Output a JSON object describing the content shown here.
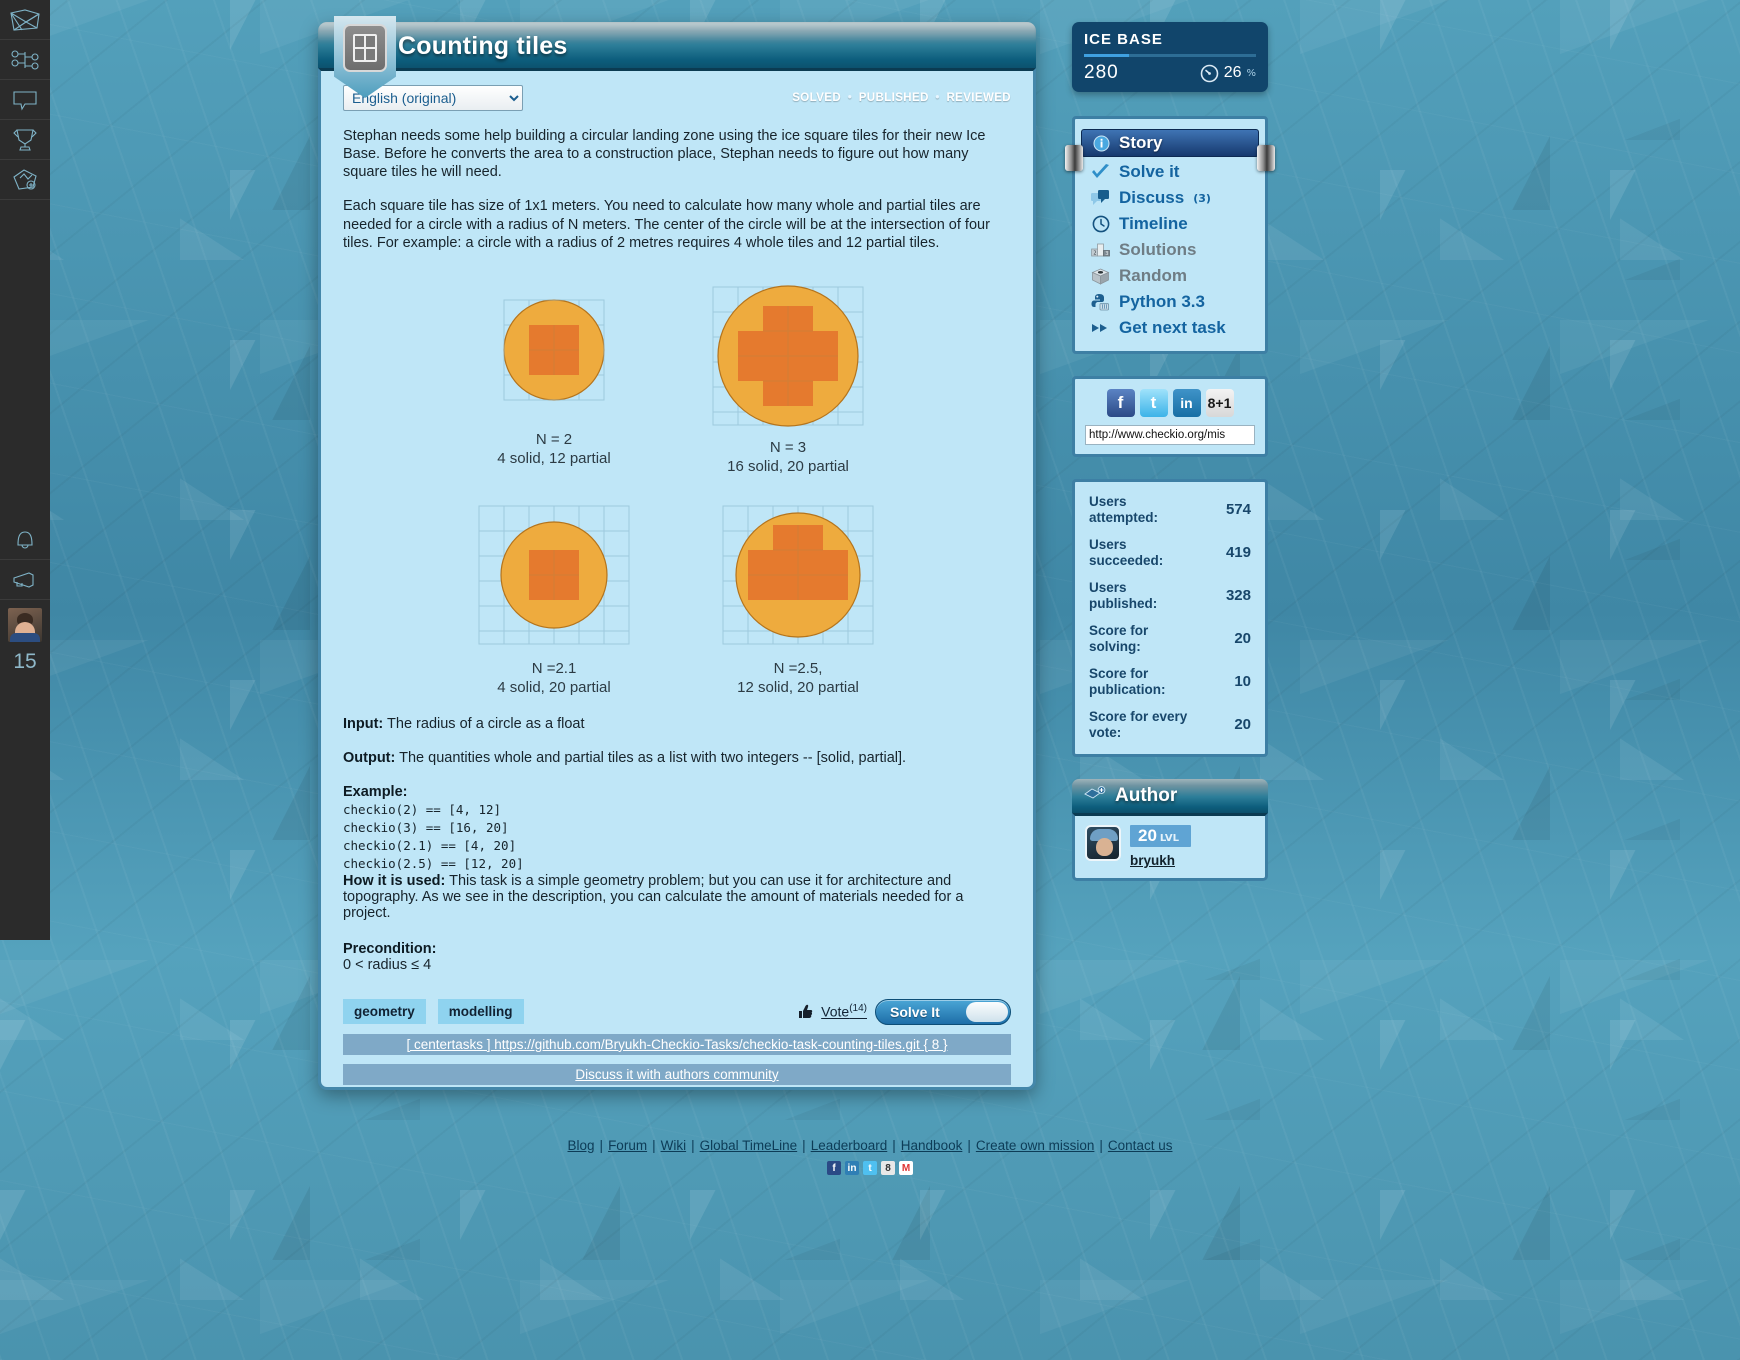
{
  "leftrail": {
    "items": [
      {
        "name": "mail-icon",
        "label": "Mail"
      },
      {
        "name": "network-icon",
        "label": "Map tree"
      },
      {
        "name": "speech-bubble-icon",
        "label": "Comments"
      },
      {
        "name": "trophy-icon",
        "label": "Awards"
      },
      {
        "name": "add-map-icon",
        "label": "New mission"
      }
    ],
    "bottom": [
      {
        "name": "bell-icon",
        "label": "Notifications"
      },
      {
        "name": "megaphone-icon",
        "label": "Announcements"
      }
    ],
    "user_level": "15"
  },
  "task": {
    "title": "Counting tiles",
    "language_selected": "English (original)",
    "language_options": [
      "English (original)"
    ],
    "status": [
      "SOLVED",
      "PUBLISHED",
      "REVIEWED"
    ],
    "status_separator": "•",
    "paragraph1": "Stephan needs some help building a circular landing zone using the ice square tiles for their new Ice Base. Before he converts the area to a construction place, Stephan needs to figure out how many square tiles he will need.",
    "paragraph2": "Each square tile has size of 1x1 meters. You need to calculate how many whole and partial tiles are needed for a circle with a radius of N meters. The center of the circle will be at the intersection of four tiles. For example: a circle with a radius of 2 metres requires 4 whole tiles and 12 partial tiles.",
    "figures": [
      {
        "caption_line1": "N = 2",
        "caption_line2": "4 solid, 12 partial",
        "radius": 2,
        "solid": 4,
        "partial": 12
      },
      {
        "caption_line1": "N = 3",
        "caption_line2": "16 solid, 20 partial",
        "radius": 3,
        "solid": 16,
        "partial": 20
      },
      {
        "caption_line1": "N =2.1",
        "caption_line2": "4 solid, 20 partial",
        "radius": 2.1,
        "solid": 4,
        "partial": 20
      },
      {
        "caption_line1": "N =2.5,",
        "caption_line2": "12 solid, 20 partial",
        "radius": 2.5,
        "solid": 12,
        "partial": 20
      }
    ],
    "input_label": "Input:",
    "input_text": "The radius of a circle as a float",
    "output_label": "Output:",
    "output_text": "The quantities whole and partial tiles as a list with two integers -- [solid, partial].",
    "example_label": "Example:",
    "example_lines": [
      "checkio(2) == [4, 12]",
      "checkio(3) == [16, 20]",
      "checkio(2.1) == [4, 20]",
      "checkio(2.5) == [12, 20]"
    ],
    "howused_label": "How it is used:",
    "howused_text": "This task is a simple geometry problem; but you can use it for architecture and topography. As we see in the description, you can calculate the amount of materials needed for a project.",
    "precondition_label": "Precondition:",
    "precondition_text": "0 < radius ≤ 4",
    "tags": [
      "geometry",
      "modelling"
    ],
    "vote_label": "Vote",
    "vote_count": "(14)",
    "solve_button": "Solve It",
    "repo_link": "[ centertasks ] https://github.com/Bryukh-Checkio-Tasks/checkio-task-counting-tiles.git { 8 }",
    "discuss_link": "Discuss it with authors community"
  },
  "icebase": {
    "title": "ICE BASE",
    "points": "280",
    "percent": "26",
    "percent_symbol": "%",
    "progress_fraction": 26
  },
  "nav": {
    "header": {
      "label": "Story",
      "icon": "info-icon"
    },
    "items": [
      {
        "label": "Solve it",
        "icon": "check-icon",
        "count": "",
        "muted": false
      },
      {
        "label": "Discuss",
        "icon": "comments-icon",
        "count": "(3)",
        "muted": false
      },
      {
        "label": "Timeline",
        "icon": "clock-icon",
        "count": "",
        "muted": false
      },
      {
        "label": "Solutions",
        "icon": "podium-icon",
        "count": "",
        "muted": true
      },
      {
        "label": "Random",
        "icon": "dice-icon",
        "count": "",
        "muted": true
      },
      {
        "label": "Python 3.3",
        "icon": "python-icon",
        "count": "",
        "muted": false
      },
      {
        "label": "Get next task",
        "icon": "fast-forward-icon",
        "count": "",
        "muted": false
      }
    ]
  },
  "social": {
    "buttons": [
      {
        "name": "facebook-share-button",
        "glyph": "f"
      },
      {
        "name": "twitter-share-button",
        "glyph": "t"
      },
      {
        "name": "linkedin-share-button",
        "glyph": "in"
      },
      {
        "name": "googleplus-share-button",
        "glyph": "8+1"
      }
    ],
    "url_value": "http://www.checkio.org/mis"
  },
  "stats": {
    "rows": [
      {
        "key": "Users attempted:",
        "value": "574"
      },
      {
        "key": "Users succeeded:",
        "value": "419"
      },
      {
        "key": "Users published:",
        "value": "328"
      },
      {
        "key": "Score for solving:",
        "value": "20"
      },
      {
        "key": "Score for publication:",
        "value": "10"
      },
      {
        "key": "Score for every vote:",
        "value": "20"
      }
    ]
  },
  "author": {
    "header": "Author",
    "level": "20",
    "level_suffix": "LVL",
    "username": "bryukh"
  },
  "footer": {
    "links": [
      "Blog",
      "Forum",
      "Wiki",
      "Global TimeLine",
      "Leaderboard",
      "Handbook",
      "Create own mission",
      "Contact us"
    ],
    "separator": "|",
    "icons": [
      {
        "name": "facebook-icon",
        "glyph": "f"
      },
      {
        "name": "linkedin-icon",
        "glyph": "in"
      },
      {
        "name": "twitter-icon",
        "glyph": "t"
      },
      {
        "name": "googleplus-icon",
        "glyph": "8"
      },
      {
        "name": "gmail-icon",
        "glyph": "M"
      }
    ]
  },
  "colors": {
    "accent": "#1464a0",
    "panel_bg": "#bfe6f7",
    "panel_border": "#3d7fa4",
    "tile_fill": "#e8a33d",
    "tile_solid": "#e2762e",
    "water": "#4b92ad"
  }
}
